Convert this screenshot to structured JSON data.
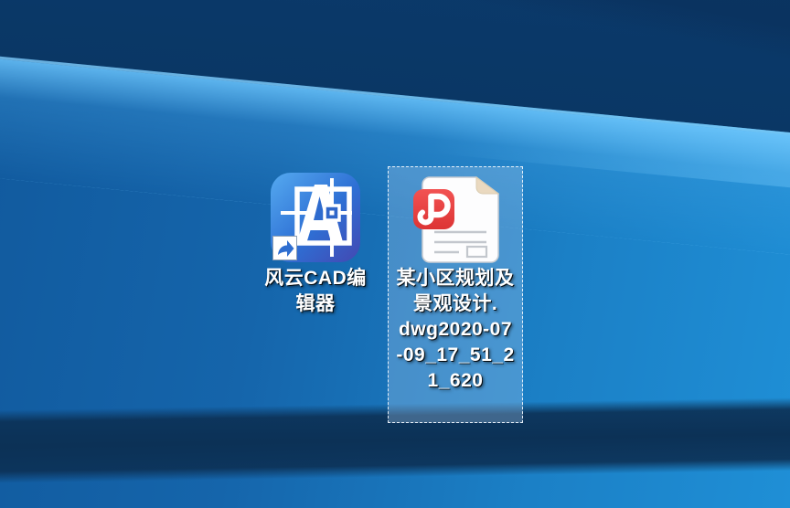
{
  "desktop": {
    "wallpaper": {
      "style": "windows-10-hero-blue",
      "base_dark": "#0b3a6c",
      "base_mid": "#1565ab",
      "base_bright": "#1f8fd6",
      "bottom_band": "#0c3156",
      "beam_highlight": "#6ec8ff"
    },
    "icons": [
      {
        "id": "cad-editor-shortcut",
        "type": "application-shortcut",
        "selected": false,
        "label": "风云CAD编辑器",
        "label_lines": [
          "风云CAD编",
          "辑器"
        ],
        "icon_colors": {
          "tile_top": "#55aaf0",
          "tile_mid": "#2e6fd4",
          "tile_bottom": "#4348b2",
          "glyph": "#ffffff"
        }
      },
      {
        "id": "dwg-file",
        "type": "file",
        "selected": true,
        "label": "某小区规划及景观设计.dwg2020-07-09_17_51_21_620",
        "label_lines": [
          "某小区规划及",
          "景观设计.",
          "dwg2020-07",
          "-09_17_51_2",
          "1_620"
        ],
        "icon_colors": {
          "page": "#fdfdfe",
          "fold": "#ead9c0",
          "badge": "#ee4545",
          "badge_glyph": "#ffffff",
          "rule_lines": "#c3c7cd"
        }
      }
    ]
  }
}
